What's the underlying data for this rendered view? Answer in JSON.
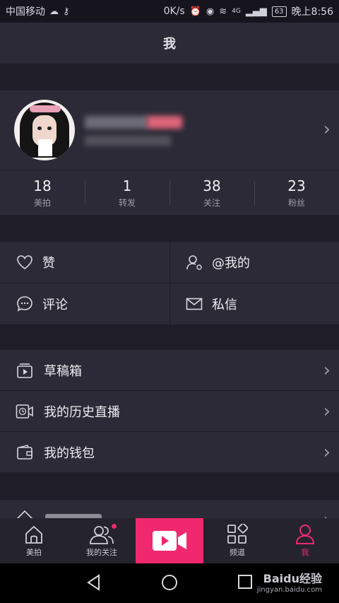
{
  "status_bar": {
    "carrier": "中国移动",
    "speed": "0K/s",
    "network": "4G",
    "battery": "63",
    "time": "晚上8:56"
  },
  "header": {
    "title": "我"
  },
  "stats": [
    {
      "value": "18",
      "label": "美拍"
    },
    {
      "value": "1",
      "label": "转发"
    },
    {
      "value": "38",
      "label": "关注"
    },
    {
      "value": "23",
      "label": "粉丝"
    }
  ],
  "quick_actions": {
    "like": "赞",
    "mention": "@我的",
    "comment": "评论",
    "message": "私信"
  },
  "menu": {
    "drafts": "草稿箱",
    "live_history": "我的历史直播",
    "wallet": "我的钱包"
  },
  "tabs": {
    "meipai": "美拍",
    "following": "我的关注",
    "channel": "频道",
    "me": "我"
  },
  "watermark": {
    "brand": "Baidu经验",
    "url": "jingyan.baidu.com"
  },
  "colors": {
    "accent": "#f0296e",
    "panel": "#2b2a36",
    "background": "#1e1d28"
  }
}
